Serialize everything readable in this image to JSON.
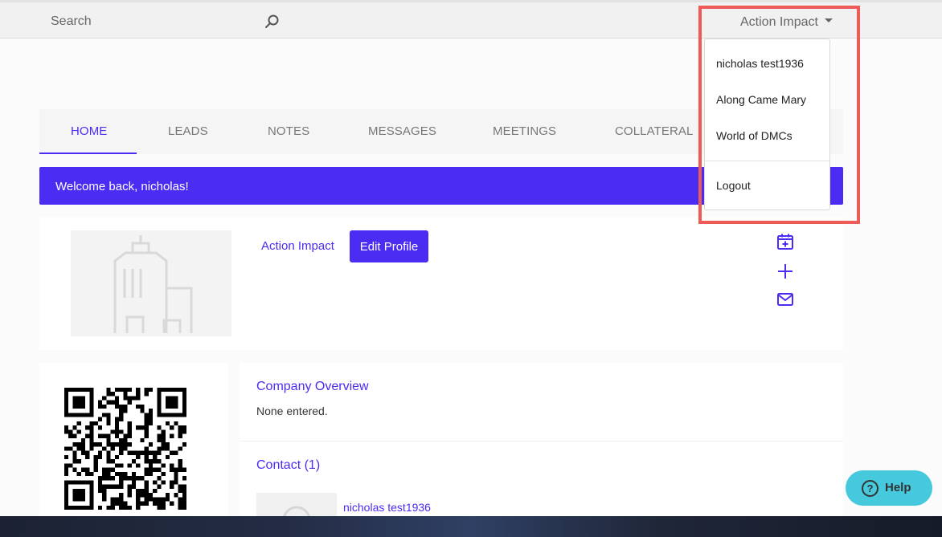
{
  "topbar": {
    "search_label": "Search",
    "account_label": "Action Impact"
  },
  "tabs": [
    "HOME",
    "LEADS",
    "NOTES",
    "MESSAGES",
    "MEETINGS",
    "COLLATERAL"
  ],
  "welcome": "Welcome back, nicholas!",
  "profile": {
    "company_link": "Action Impact",
    "edit_button": "Edit Profile"
  },
  "overview": {
    "title": "Company Overview",
    "text": "None entered."
  },
  "contact": {
    "title": "Contact (1)",
    "name": "nicholas test1936"
  },
  "dropdown": {
    "items": [
      "nicholas test1936",
      "Along Came Mary",
      "World of DMCs"
    ],
    "logout": "Logout"
  },
  "help": {
    "label": "Help"
  },
  "colors": {
    "accent": "#4a2cf2",
    "highlight": "#ee5a55",
    "help": "#46c8dd"
  }
}
